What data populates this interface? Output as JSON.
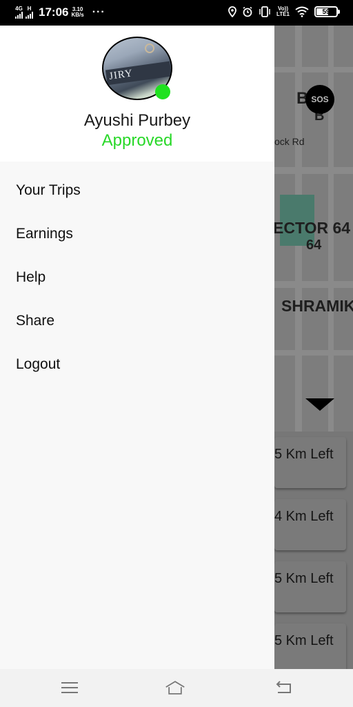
{
  "status_bar": {
    "network_1": "4G",
    "network_2": "H",
    "time": "17:06",
    "speed_value": "3.10",
    "speed_unit": "KB/s",
    "more": "···",
    "volte_top": "Vo))",
    "volte_bottom": "LTE1",
    "battery": "59",
    "icons": [
      "location-icon",
      "alarm-icon",
      "vibrate-icon",
      "wifi-icon",
      "battery-icon"
    ]
  },
  "drawer": {
    "user_name": "Ayushi Purbey",
    "status": "Approved",
    "avatar_text": "JIRY",
    "menu": [
      {
        "label": "Your Trips"
      },
      {
        "label": "Earnings"
      },
      {
        "label": "Help"
      },
      {
        "label": "Share"
      },
      {
        "label": "Logout"
      }
    ]
  },
  "map": {
    "labels": [
      "B",
      "B",
      "ock Rd",
      "ECTOR 64",
      "64",
      "SHRAMIK"
    ],
    "sos_label": "SOS"
  },
  "rides": [
    {
      "distance": "5 Km Left"
    },
    {
      "distance": "4 Km Left"
    },
    {
      "distance": "5 Km Left"
    },
    {
      "distance": "5 Km Left"
    }
  ],
  "nav_bar": {
    "icons": [
      "menu-icon",
      "home-icon",
      "back-icon"
    ]
  },
  "colors": {
    "status_approved": "#28d828",
    "online_dot": "#1fe21f",
    "map_overlay": "#7d7d7d"
  }
}
